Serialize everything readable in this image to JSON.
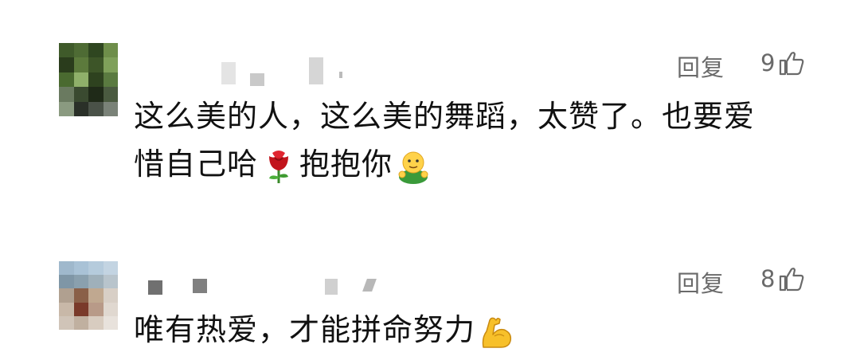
{
  "comments": [
    {
      "reply_label": "回复",
      "like_count": "9",
      "text_line1": "这么美的人，这么美的舞蹈，太赞了。也要爱",
      "text_line2_a": "惜自己哈",
      "text_line2_b": "抱抱你",
      "emojis": [
        "rose-icon",
        "hugging-face-icon"
      ]
    },
    {
      "reply_label": "回复",
      "like_count": "8",
      "text": "唯有热爱，才能拼命努力",
      "emojis": [
        "flexed-biceps-icon"
      ]
    }
  ],
  "colors": {
    "meta_gray": "#6a6a6a",
    "text": "#111111",
    "background": "#ffffff"
  }
}
